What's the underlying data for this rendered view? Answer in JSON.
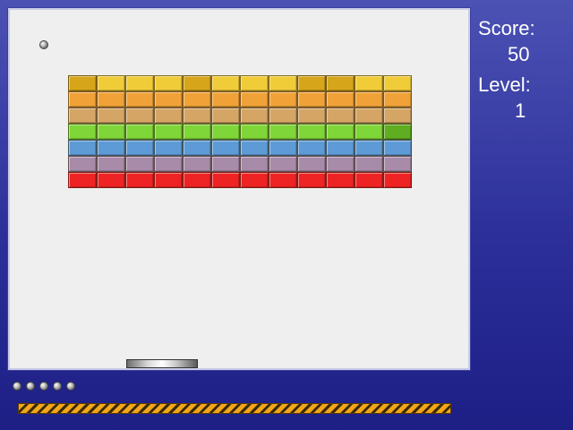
{
  "hud": {
    "score_label": "Score:",
    "score_value": "50",
    "level_label": "Level:",
    "level_value": "1"
  },
  "bricks": {
    "columns": 12,
    "rows": [
      [
        "#d6a51a",
        "#f1cc39",
        "#f1cc39",
        "#f1cc39",
        "#d6a51a",
        "#f1cc39",
        "#f1cc39",
        "#f1cc39",
        "#d6a51a",
        "#d6a51a",
        "#f1cc39",
        "#f1cc39"
      ],
      [
        "#f0a238",
        "#f0a238",
        "#f0a238",
        "#f0a238",
        "#f0a238",
        "#f0a238",
        "#f0a238",
        "#f0a238",
        "#f0a238",
        "#f0a238",
        "#f0a238",
        "#f0a238"
      ],
      [
        "#d5a566",
        "#d5a566",
        "#d5a566",
        "#d5a566",
        "#d5a566",
        "#d5a566",
        "#d5a566",
        "#d5a566",
        "#d5a566",
        "#d5a566",
        "#d5a566",
        "#d5a566"
      ],
      [
        "#7fd638",
        "#7fd638",
        "#7fd638",
        "#7fd638",
        "#7fd638",
        "#7fd638",
        "#7fd638",
        "#7fd638",
        "#7fd638",
        "#7fd638",
        "#7fd638",
        "#5fae22"
      ],
      [
        "#5e9bd6",
        "#5e9bd6",
        "#5e9bd6",
        "#5e9bd6",
        "#5e9bd6",
        "#5e9bd6",
        "#5e9bd6",
        "#5e9bd6",
        "#5e9bd6",
        "#5e9bd6",
        "#5e9bd6",
        "#5e9bd6"
      ],
      [
        "#a88aa9",
        "#a88aa9",
        "#a88aa9",
        "#a88aa9",
        "#a88aa9",
        "#a88aa9",
        "#a88aa9",
        "#a88aa9",
        "#a88aa9",
        "#a88aa9",
        "#a88aa9",
        "#a88aa9"
      ],
      [
        "#ee2324",
        "#ee2324",
        "#ee2324",
        "#ee2324",
        "#ee2324",
        "#ee2324",
        "#ee2324",
        "#ee2324",
        "#ee2324",
        "#ee2324",
        "#ee2324",
        "#ee2324"
      ]
    ]
  },
  "lives": {
    "remaining": 5
  },
  "power_bar": {
    "level": 1.0
  },
  "colors": {
    "background_top": "#4b52b3",
    "background_bottom": "#1d1f85",
    "playfield": "#efefef"
  }
}
